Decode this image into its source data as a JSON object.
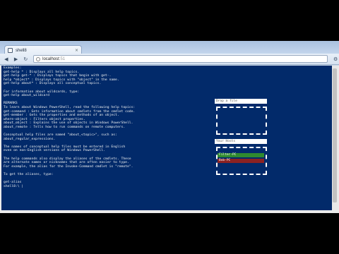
{
  "browser": {
    "tab_title": "shell8",
    "tab_close": "×",
    "url_host": "localhost",
    "url_port": ":51"
  },
  "terminal": {
    "lines": [
      "Examples:",
      "get-help * : Displays all help topics.",
      "get-help get-* : Displays topics that begin with get-.",
      "help *object* : Displays topics with \"object\" in the name.",
      "get-help about* : Displays all conceptual topics.",
      "",
      "For information about wildcards, type:",
      "get-help about_wildcard",
      "",
      "REMARKS",
      "To learn about Windows PowerShell, read the following help topics:",
      "get-command : Gets information about cmdlets from the cmdlet code.",
      "get-member : Gets the properties and methods of an object.",
      "where-object : Filters object properties.",
      "about_object : Explains the use of objects in Windows PowerShell.",
      "about_remote : Tells how to run commands on remote computers.",
      "",
      "Conceptual help files are named \"about_<topic>\", such as:",
      "about_regular_expressions.",
      "",
      "The names of conceptual help files must be entered in English",
      "even on non-English versions of Windows PowerShell.",
      "",
      "The help commands also display the aliases of the cmdlets. These",
      "are alternate names or nicknames that are often easier to type.",
      "For example, the alias for the Invoke-Command cmdlet is \"remote\".",
      "",
      "To get the aliases, type:",
      "",
      "get-alias",
      "shell8:\\ |"
    ]
  },
  "drop_panel": {
    "label": "Drop a file"
  },
  "hosts_panel": {
    "label": "Your Hosts",
    "hosts": [
      {
        "name": "Filter-PC",
        "status_color": "#2f8a2f"
      },
      {
        "name": "Bob-PC",
        "status_color": "#8c2222"
      }
    ]
  },
  "colors": {
    "console_bg": "#022a6a",
    "console_text": "#f0f0f0"
  }
}
